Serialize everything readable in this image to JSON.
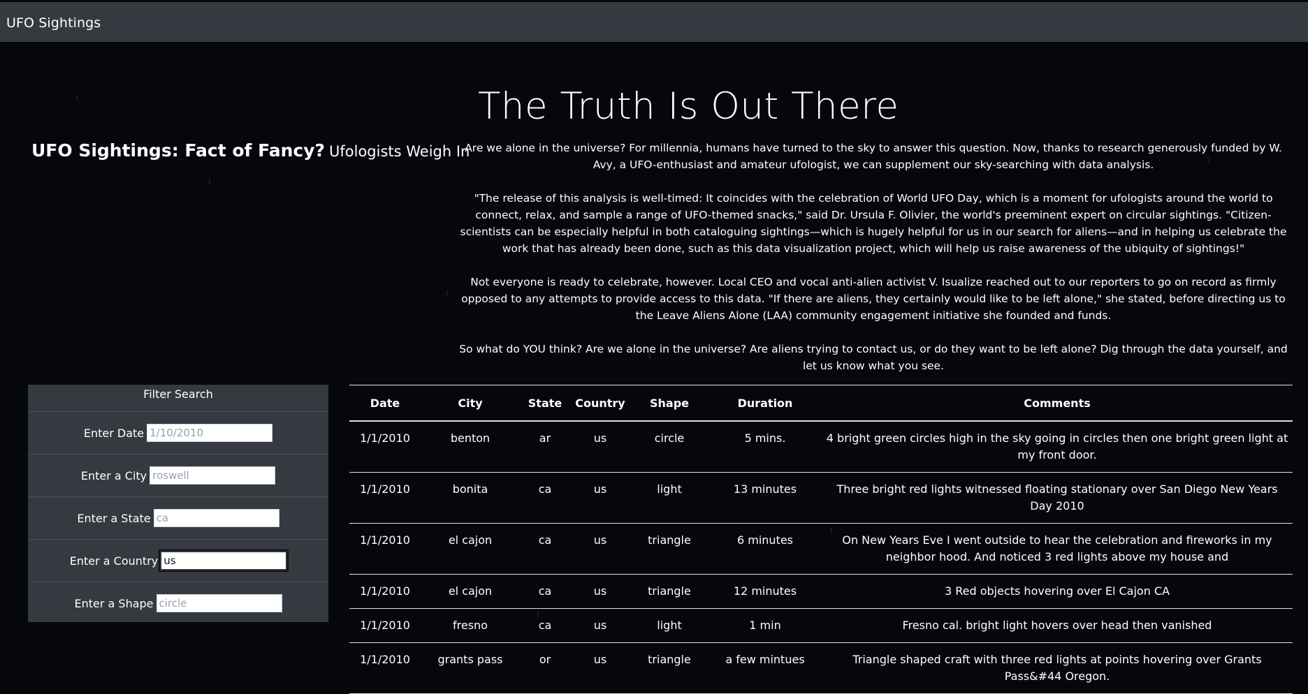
{
  "navbar": {
    "brand": "UFO Sightings"
  },
  "hero": {
    "title": "The Truth Is Out There"
  },
  "side": {
    "heading": "UFO Sightings: Fact of Fancy?",
    "subheading": "Ufologists Weigh In"
  },
  "intro": {
    "paragraphs": [
      "Are we alone in the universe? For millennia, humans have turned to the sky to answer this question. Now, thanks to research generously funded by W. Avy, a UFO-enthusiast and amateur ufologist, we can supplement our sky-searching with data analysis.",
      "\"The release of this analysis is well-timed: It coincides with the celebration of World UFO Day, which is a moment for ufologists around the world to connect, relax, and sample a range of UFO-themed snacks,\" said Dr. Ursula F. Olivier, the world's preeminent expert on circular sightings. \"Citizen-scientists can be especially helpful in both cataloguing sightings—which is hugely helpful for us in our search for aliens—and in helping us celebrate the work that has already been done, such as this data visualization project, which will help us raise awareness of the ubiquity of sightings!\"",
      "Not everyone is ready to celebrate, however. Local CEO and vocal anti-alien activist V. Isualize reached out to our reporters to go on record as firmly opposed to any attempts to provide access to this data. \"If there are aliens, they certainly would like to be left alone,\" she stated, before directing us to the Leave Aliens Alone (LAA) community engagement initiative she founded and funds.",
      "So what do YOU think? Are we alone in the universe? Are aliens trying to contact us, or do they want to be left alone? Dig through the data yourself, and let us know what you see."
    ]
  },
  "filters": {
    "title": "Filter Search",
    "date": {
      "label": "Enter Date",
      "placeholder": "1/10/2010",
      "value": ""
    },
    "city": {
      "label": "Enter a City",
      "placeholder": "roswell",
      "value": ""
    },
    "state": {
      "label": "Enter a State",
      "placeholder": "ca",
      "value": ""
    },
    "country": {
      "label": "Enter a Country",
      "placeholder": "",
      "value": "us"
    },
    "shape": {
      "label": "Enter a Shape",
      "placeholder": "circle",
      "value": ""
    }
  },
  "table": {
    "headers": [
      "Date",
      "City",
      "State",
      "Country",
      "Shape",
      "Duration",
      "Comments"
    ],
    "rows": [
      [
        "1/1/2010",
        "benton",
        "ar",
        "us",
        "circle",
        "5 mins.",
        "4 bright green circles high in the sky going in circles then one bright green light at my front door."
      ],
      [
        "1/1/2010",
        "bonita",
        "ca",
        "us",
        "light",
        "13 minutes",
        "Three bright red lights witnessed floating stationary over San Diego New Years Day 2010"
      ],
      [
        "1/1/2010",
        "el cajon",
        "ca",
        "us",
        "triangle",
        "6 minutes",
        "On New Years Eve I went outside to hear the celebration and fireworks in my neighbor hood. And noticed 3 red lights above my house and"
      ],
      [
        "1/1/2010",
        "el cajon",
        "ca",
        "us",
        "triangle",
        "12 minutes",
        "3 Red objects hovering over El Cajon CA"
      ],
      [
        "1/1/2010",
        "fresno",
        "ca",
        "us",
        "light",
        "1 min",
        "Fresno cal. bright light hovers over head then vanished"
      ],
      [
        "1/1/2010",
        "grants pass",
        "or",
        "us",
        "triangle",
        "a few mintues",
        "Triangle shaped craft with three red lights at points hovering over Grants Pass&#44 Oregon."
      ]
    ]
  }
}
